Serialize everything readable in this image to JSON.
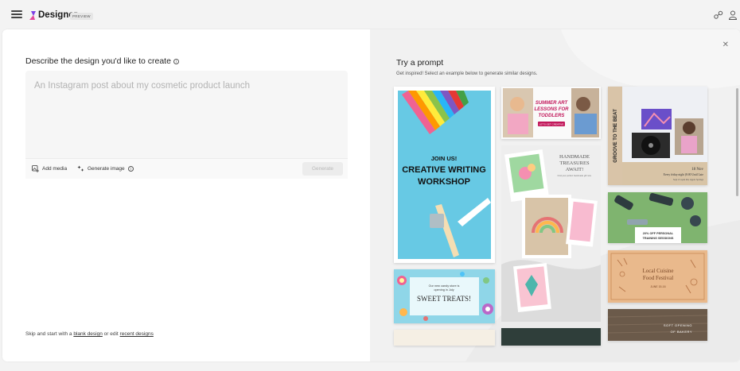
{
  "topbar": {
    "brand": "Designer",
    "badge": "PREVIEW"
  },
  "left": {
    "describe_label": "Describe the design you'd like to create",
    "prompt_placeholder": "An Instagram post about my cosmetic product launch",
    "add_media": "Add media",
    "generate_image": "Generate image",
    "generate_button": "Generate",
    "footer": {
      "prefix": "Skip and start with a",
      "blank_design": "blank design",
      "middle": "or edit",
      "recent_designs": "recent designs"
    }
  },
  "right": {
    "title": "Try a prompt",
    "subtitle": "Get inspired! Select an example below to generate similar designs.",
    "tiles": {
      "writing_join": "JOIN US!",
      "writing_title_1": "CREATIVE WRITING",
      "writing_title_2": "WORKSHOP",
      "summer_title_1": "SUMMER ART",
      "summer_title_2": "LESSONS FOR",
      "summer_title_3": "TODDLERS",
      "summer_cta": "LET'S GET CREATIVE",
      "handmade_1": "HANDMADE",
      "handmade_2": "TREASURES",
      "handmade_3": "AWAIT!",
      "handmade_small": "Find your perfect handmade gift now.",
      "groove": "GROOVE TO THE BEAT",
      "groove_date": "18 Nov",
      "groove_info_1": "Every friday night (8:00 Until Late",
      "groove_info_2": "Sept 2 Lapin Rd, Apple Springs",
      "training_1": "20% OFF PERSONAL",
      "training_2": "TRAINING SESSIONS",
      "sweet_small_1": "Our new candy store is",
      "sweet_small_2": "opening in July",
      "sweet_title": "SWEET TREATS!",
      "cuisine_1": "Local Cuisine",
      "cuisine_2": "Food Festival",
      "cuisine_date": "JUNE 15-16",
      "bakery_1": "SOFT OPENING",
      "bakery_2": "OF BAKERY"
    }
  },
  "colors": {
    "accent": "#7b3fe4",
    "logo_pink": "#e3489a",
    "groove_purple": "#7a5bd6",
    "training_green": "#7fb46f",
    "cuisine_orange": "#e9b98c",
    "sweet_blue": "#8fd6e8"
  },
  "icons": [
    "hamburger-icon",
    "designer-logo-icon",
    "share-icon",
    "account-icon",
    "info-icon",
    "add-media-icon",
    "generate-image-icon",
    "close-icon"
  ]
}
